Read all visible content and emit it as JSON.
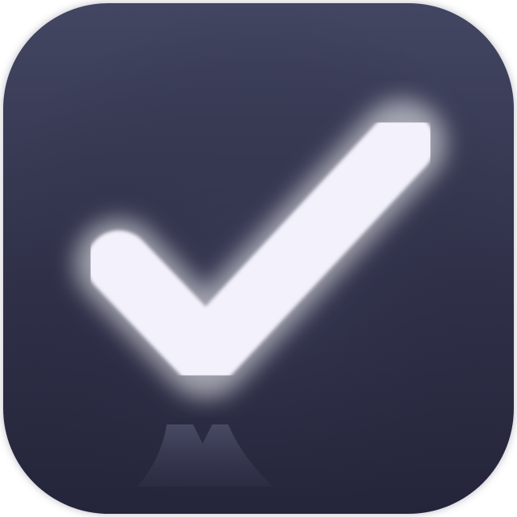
{
  "icon": {
    "name": "checkmark-icon",
    "colors": {
      "background_top": "#434662",
      "background_bottom": "#24253a",
      "check_fill": "#f3f1fb",
      "check_glow": "#ffffff",
      "reflection": "#4a4c66"
    }
  }
}
